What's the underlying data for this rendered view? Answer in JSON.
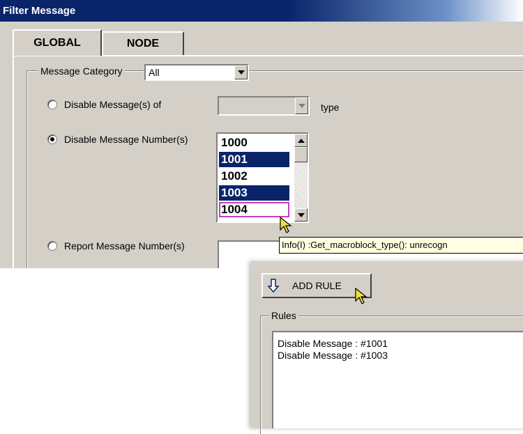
{
  "window": {
    "title": "Filter Message"
  },
  "tabs": [
    {
      "label": "GLOBAL",
      "active": true
    },
    {
      "label": "NODE",
      "active": false
    }
  ],
  "category": {
    "label": "Message Category",
    "value": "All"
  },
  "options": {
    "disable_type": {
      "label": "Disable Message(s) of",
      "suffix": "type",
      "selected": false,
      "value": ""
    },
    "disable_numbers": {
      "label": "Disable Message Number(s)",
      "selected": true
    },
    "report_numbers": {
      "label": "Report Message Number(s)",
      "selected": false
    }
  },
  "message_numbers": [
    {
      "value": "1000",
      "selected": false
    },
    {
      "value": "1001",
      "selected": true
    },
    {
      "value": "1002",
      "selected": false
    },
    {
      "value": "1003",
      "selected": true
    },
    {
      "value": "1004",
      "selected": false
    }
  ],
  "tooltip": "Info(I) :Get_macroblock_type():  unrecogn",
  "add_rule": {
    "label": "ADD RULE"
  },
  "rules": {
    "label": "Rules",
    "items": [
      "Disable Message : #1001",
      "Disable Message : #1003"
    ]
  },
  "colors": {
    "dialog_bg": "#d4d0c8",
    "title_bar": "#0a246a",
    "selection": "#0a246a",
    "tooltip_bg": "#ffffe1",
    "cursor": "#f0e040"
  }
}
